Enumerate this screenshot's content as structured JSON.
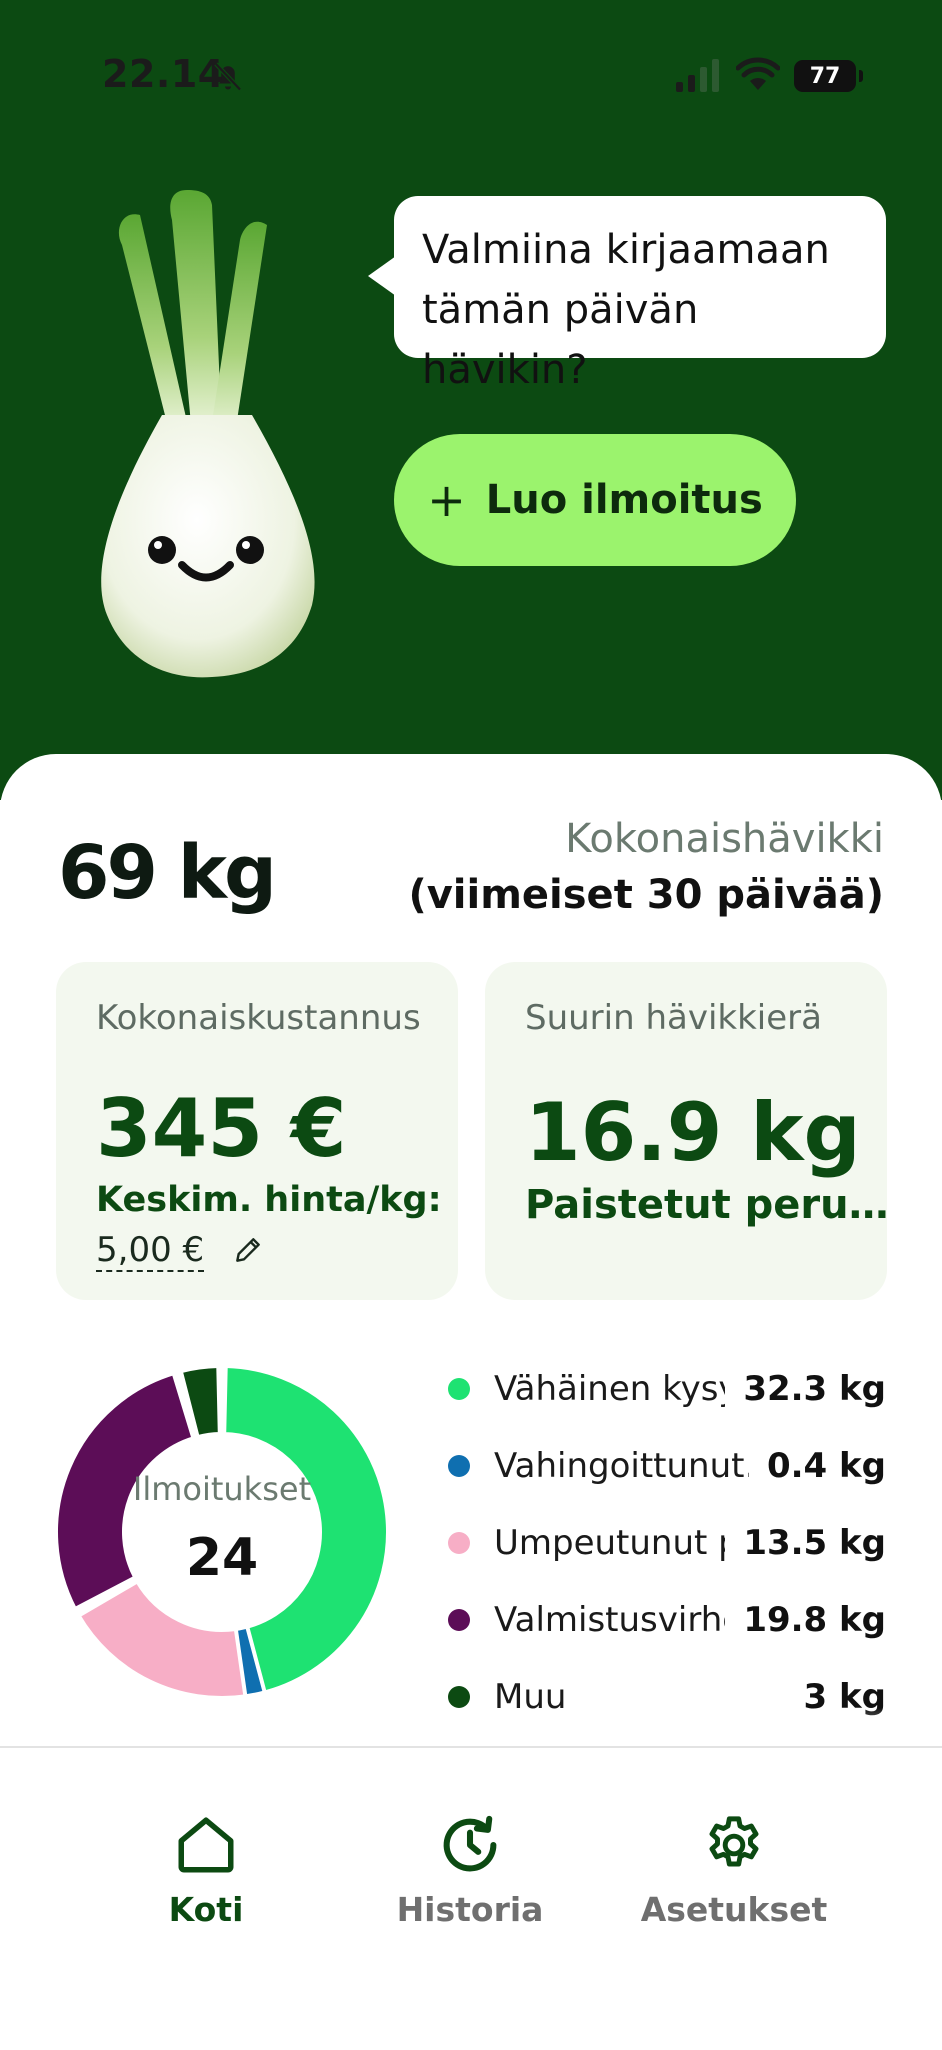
{
  "status_bar": {
    "time": "22.14",
    "battery": "77"
  },
  "hero": {
    "bubble_text": "Valmiina kirjaamaan tämän päivän hävikin?",
    "create_button": "Luo ilmoitus"
  },
  "summary": {
    "total_value": "69 kg",
    "total_label": "Kokonaishävikki",
    "period": "(viimeiset 30 päivää)"
  },
  "cards": {
    "cost_title": "Kokonaiskustannus",
    "cost_value": "345 €",
    "avg_label": "Keskim. hinta/kg:",
    "avg_value": "5,00 €",
    "largest_title": "Suurin hävikkierä",
    "largest_value": "16.9 kg",
    "largest_name": "Paistetut peru…"
  },
  "donut": {
    "center_label": "Ilmoitukset",
    "center_value": "24"
  },
  "chart_data": {
    "type": "pie",
    "categories": [
      "Vähäinen kysy…",
      "Vahingoittunut…",
      "Umpeutunut p…",
      "Valmistusvirhe",
      "Muu"
    ],
    "values": [
      32.3,
      0.4,
      13.5,
      19.8,
      3
    ],
    "unit": "kg",
    "colors": [
      "#1ee272",
      "#0f6fb0",
      "#f7aec6",
      "#5c0d57",
      "#0c4a12"
    ]
  },
  "legend": [
    {
      "name": "Vähäinen kysy…",
      "value": "32.3 kg",
      "color": "#1ee272"
    },
    {
      "name": "Vahingoittunut…",
      "value": "0.4 kg",
      "color": "#0f6fb0"
    },
    {
      "name": "Umpeutunut p…",
      "value": "13.5 kg",
      "color": "#f7aec6"
    },
    {
      "name": "Valmistusvirhe",
      "value": "19.8 kg",
      "color": "#5c0d57"
    },
    {
      "name": "Muu",
      "value": "3 kg",
      "color": "#0c4a12"
    }
  ],
  "nav": {
    "home": "Koti",
    "history": "Historia",
    "settings": "Asetukset"
  },
  "icons": [
    "bell-off-icon",
    "signal-icon",
    "wifi-icon",
    "battery-icon",
    "plus-icon",
    "pencil-icon",
    "home-icon",
    "history-icon",
    "settings-icon"
  ]
}
